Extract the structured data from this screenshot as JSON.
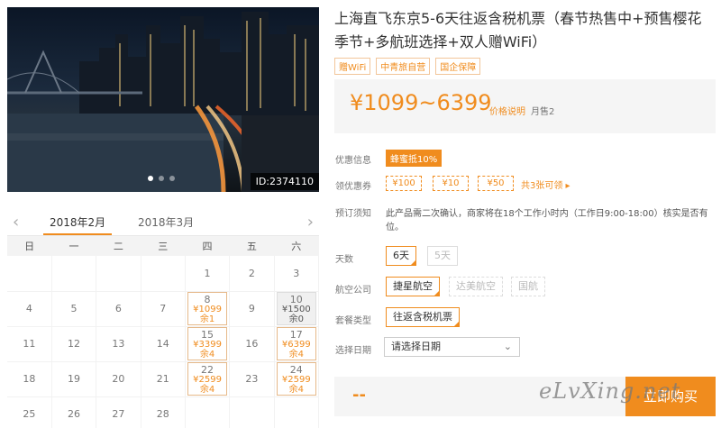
{
  "photo": {
    "id_label": "ID:2374110",
    "dots": 3
  },
  "calendar": {
    "months": [
      "2018年2月",
      "2018年3月"
    ],
    "weekdays": [
      "日",
      "一",
      "二",
      "三",
      "四",
      "五",
      "六"
    ],
    "weeks": [
      [
        {
          "d": ""
        },
        {
          "d": ""
        },
        {
          "d": ""
        },
        {
          "d": ""
        },
        {
          "d": "1"
        },
        {
          "d": "2"
        },
        {
          "d": "3"
        }
      ],
      [
        {
          "d": "4"
        },
        {
          "d": "5"
        },
        {
          "d": "6"
        },
        {
          "d": "7"
        },
        {
          "d": "8",
          "price": "¥1099",
          "remain": "余1",
          "state": "avail"
        },
        {
          "d": "9"
        },
        {
          "d": "10",
          "price": "¥1500",
          "remain": "余0",
          "state": "gray"
        }
      ],
      [
        {
          "d": "11"
        },
        {
          "d": "12"
        },
        {
          "d": "13"
        },
        {
          "d": "14"
        },
        {
          "d": "15",
          "price": "¥3399",
          "remain": "余4",
          "state": "avail"
        },
        {
          "d": "16"
        },
        {
          "d": "17",
          "price": "¥6399",
          "remain": "余4",
          "state": "avail"
        }
      ],
      [
        {
          "d": "18"
        },
        {
          "d": "19"
        },
        {
          "d": "20"
        },
        {
          "d": "21"
        },
        {
          "d": "22",
          "price": "¥2599",
          "remain": "余4",
          "state": "avail"
        },
        {
          "d": "23"
        },
        {
          "d": "24",
          "price": "¥2599",
          "remain": "余4",
          "state": "avail"
        }
      ],
      [
        {
          "d": "25"
        },
        {
          "d": "26"
        },
        {
          "d": "27"
        },
        {
          "d": "28"
        },
        {
          "d": ""
        },
        {
          "d": ""
        },
        {
          "d": ""
        }
      ]
    ]
  },
  "product": {
    "title": "上海直飞东京5-6天往返含税机票（春节热售中+预售樱花季节+多航班选择+双人赠WiFi）",
    "tags": [
      "赠WiFi",
      "中青旅自营",
      "国企保障"
    ],
    "price": "¥1099~6399",
    "price_link": "价格说明",
    "sold": "月售2"
  },
  "info": {
    "promo_label": "优惠信息",
    "promo_badge": "蜂蜜抵10%",
    "coupon_label": "领优惠券",
    "coupons": [
      "¥100",
      "¥10",
      "¥50"
    ],
    "coupon_more": "共3张可领 ▸",
    "notice_label": "预订须知",
    "notice_text": "此产品需二次确认，商家将在18个工作小时内（工作日9:00-18:00）核实是否有位。"
  },
  "options": {
    "days_label": "天数",
    "days": [
      "6天",
      "5天"
    ],
    "airline_label": "航空公司",
    "airlines": [
      "捷星航空",
      "达美航空",
      "国航"
    ],
    "package_label": "套餐类型",
    "package": "往返含税机票",
    "date_label": "选择日期",
    "date_placeholder": "请选择日期"
  },
  "footer": {
    "price_placeholder": "--",
    "buy_label": "立即购买",
    "watermark": "eLvXing.net"
  },
  "colors": {
    "accent": "#f08c1e"
  }
}
